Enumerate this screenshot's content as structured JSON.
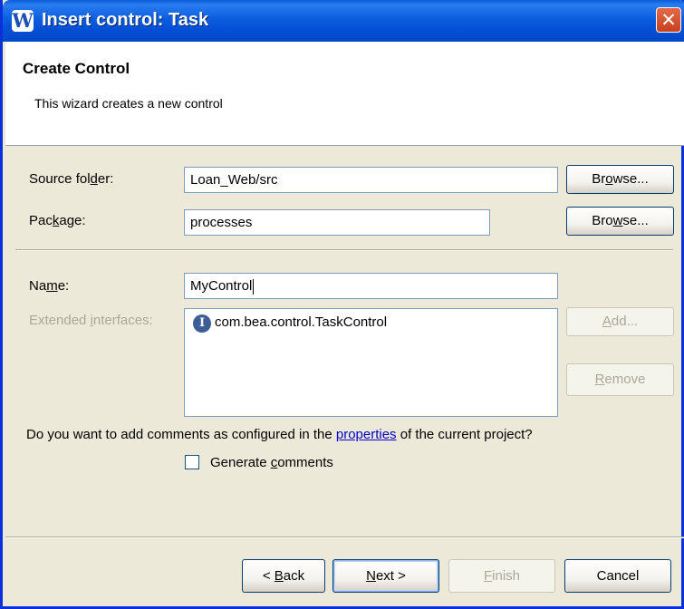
{
  "window": {
    "title": "Insert control: Task",
    "app_icon": "W",
    "close_glyph": "✕"
  },
  "header": {
    "title": "Create Control",
    "description": "This wizard creates a new control"
  },
  "source_folder": {
    "label_pre": "Source fol",
    "label_u": "d",
    "label_post": "er:",
    "value": "Loan_Web/src",
    "browse_pre": "Br",
    "browse_u": "o",
    "browse_post": "wse..."
  },
  "package": {
    "label_pre": "Pac",
    "label_u": "k",
    "label_post": "age:",
    "value": "processes",
    "browse_pre": "Bro",
    "browse_u": "w",
    "browse_post": "se..."
  },
  "name": {
    "label_pre": "Na",
    "label_u": "m",
    "label_post": "e:",
    "value": "MyControl"
  },
  "extended": {
    "label_pre": "Extended ",
    "label_u": "i",
    "label_post": "nterfaces:",
    "icon": "I",
    "items": [
      "com.bea.control.TaskControl"
    ]
  },
  "add_button": {
    "u": "A",
    "post": "dd..."
  },
  "remove_button": {
    "u": "R",
    "post": "emove"
  },
  "comments": {
    "question_pre": "Do you want to add comments as configured in the ",
    "link": "properties",
    "question_post": " of the current project?",
    "checkbox_pre": "Generate ",
    "checkbox_u": "c",
    "checkbox_post": "omments",
    "checked": false
  },
  "footer": {
    "back": {
      "pre": "< ",
      "u": "B",
      "post": "ack"
    },
    "next": {
      "u": "N",
      "post": "ext >"
    },
    "finish": {
      "u": "F",
      "post": "inish"
    },
    "cancel": "Cancel"
  }
}
